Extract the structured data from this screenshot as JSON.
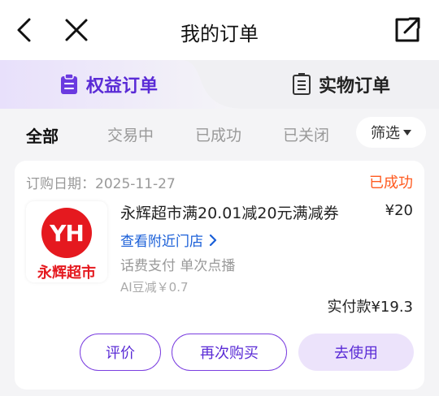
{
  "header": {
    "title": "我的订单"
  },
  "tabs": [
    {
      "label": "权益订单",
      "active": true,
      "icon": "clipboard-icon"
    },
    {
      "label": "实物订单",
      "active": false,
      "icon": "document-icon"
    }
  ],
  "filters": {
    "items": [
      "全部",
      "交易中",
      "已成功",
      "已关闭"
    ],
    "active_index": 0,
    "filter_button": "筛选"
  },
  "order": {
    "date_label": "订购日期：2025-11-27",
    "status": "已成功",
    "merchant_logo": {
      "mark": "YH",
      "name": "永辉超市"
    },
    "product_name": "永辉超市满20.01减20元满减券",
    "price": "¥20",
    "nearby_link": "查看附近门店",
    "tags": "话费支付 单次点播",
    "ai_discount": "AI豆减￥0.7",
    "paid_amount": "实付款¥19.3",
    "actions": {
      "review": "评价",
      "rebuy": "再次购买",
      "use": "去使用"
    }
  },
  "colors": {
    "accent": "#5a2bd6",
    "status": "#ff5a1f",
    "link": "#1a5fd8",
    "brand_red": "#e5191f"
  }
}
